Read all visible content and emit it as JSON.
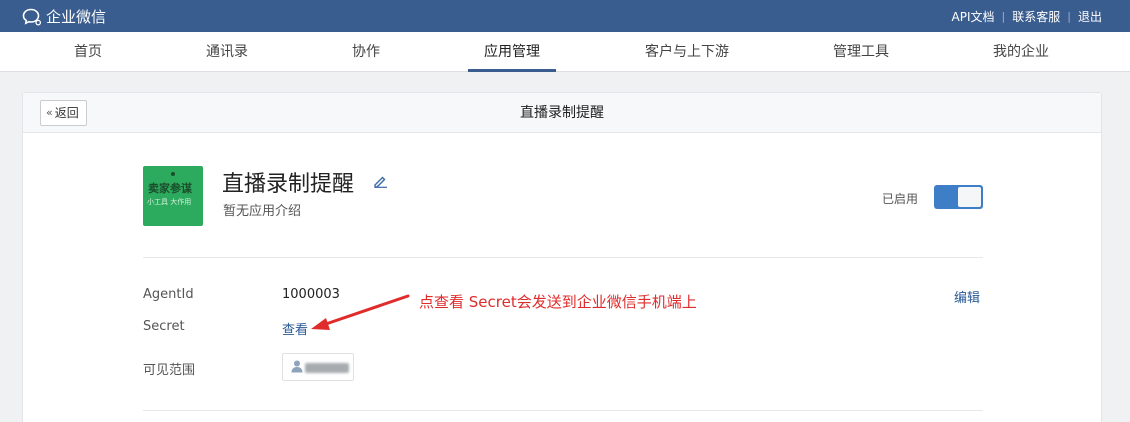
{
  "topbar": {
    "logo_text": "企业微信",
    "links": [
      "API文档",
      "联系客服",
      "退出"
    ]
  },
  "nav": {
    "items": [
      "首页",
      "通讯录",
      "协作",
      "应用管理",
      "客户与上下游",
      "管理工具",
      "我的企业"
    ],
    "active": "应用管理"
  },
  "card": {
    "back_label": "返回",
    "title": "直播录制提醒"
  },
  "app": {
    "logo_text": "卖家参谋",
    "logo_subtext": "小工具 大作用",
    "name": "直播录制提醒",
    "description": "暂无应用介绍",
    "status_label": "已启用",
    "enabled": true
  },
  "details": {
    "agentid_label": "AgentId",
    "agentid_value": "1000003",
    "secret_label": "Secret",
    "secret_link": "查看",
    "scope_label": "可见范围",
    "edit_label": "编辑"
  },
  "annotation": {
    "text": "点查看 Secret会发送到企业微信手机端上",
    "color": "#e02b2b"
  },
  "colors": {
    "topbar": "#3a5d8f",
    "toggle_on": "#3d7ec7",
    "link": "#2a5a96",
    "logo_bg": "#2cab5f"
  }
}
